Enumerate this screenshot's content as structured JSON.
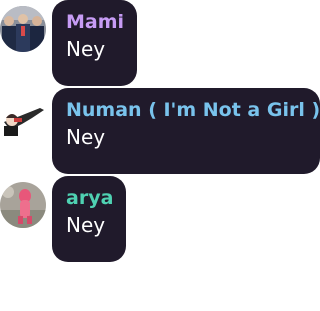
{
  "messages": [
    {
      "sender": "Mami",
      "sender_color": "#c79cf5",
      "text": "Ney",
      "avatar": "group-photo-avatar"
    },
    {
      "sender": "Numan ( I'm Not a Girl )",
      "sender_color": "#79c3ec",
      "text": "Ney",
      "avatar": "anime-character-avatar"
    },
    {
      "sender": "arya",
      "sender_color": "#4fd1b2",
      "text": "Ney",
      "avatar": "pink-figure-avatar"
    }
  ],
  "colors": {
    "bubble_background": "#201a2b",
    "message_text": "#ffffff",
    "page_background": "#ffffff"
  }
}
